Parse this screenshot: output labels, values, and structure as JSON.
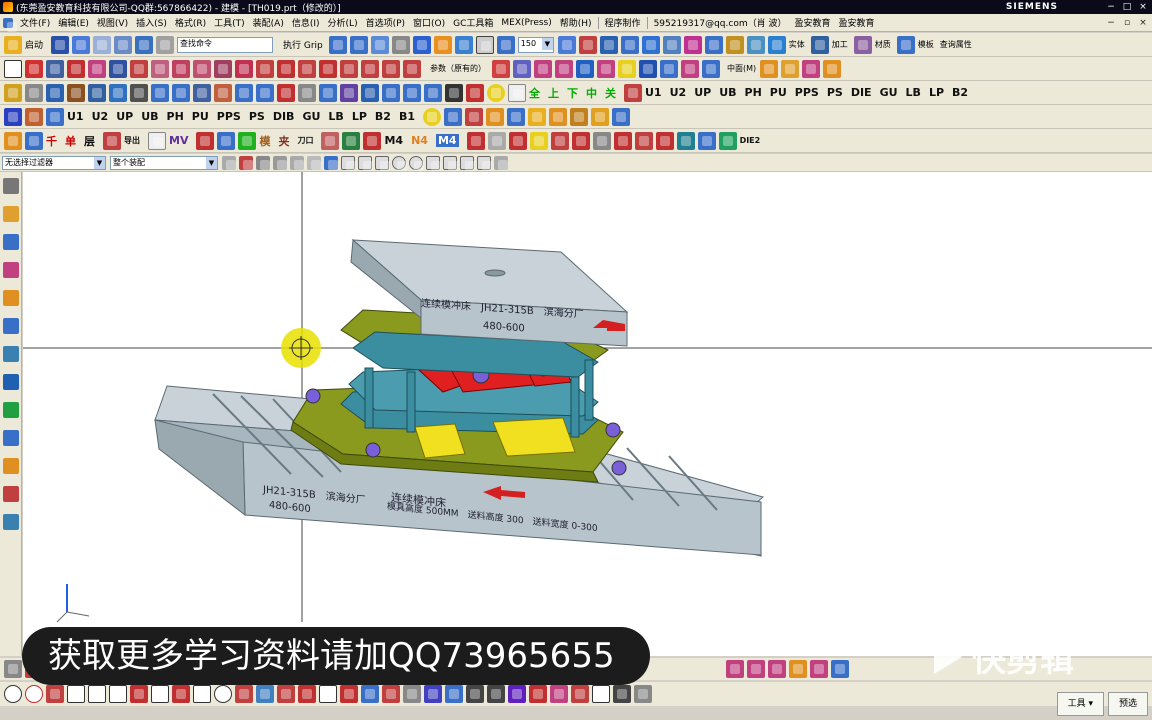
{
  "window": {
    "title": "(东莞盈安教育科技有限公司-QQ群:567866422) - 建模 - [TH019.prt（修改的）]",
    "brand": "SIEMENS",
    "controls": [
      "−",
      "□",
      "×"
    ]
  },
  "menu": [
    "文件(F)",
    "编辑(E)",
    "视图(V)",
    "插入(S)",
    "格式(R)",
    "工具(T)",
    "装配(A)",
    "信息(I)",
    "分析(L)",
    "首选项(P)",
    "窗口(O)",
    "GC工具箱",
    "MEX(Press)",
    "帮助(H)",
    "程序制作",
    "595219317@qq.com（肖 波）",
    "盈安教育",
    "盈安教育"
  ],
  "toolbar1": {
    "start_label": "启动",
    "search_placeholder": "查找命令",
    "grip_label": "执行 Grip",
    "zoom_value": "150",
    "right_labels": [
      "实体",
      "加工",
      "材质",
      "模板",
      "查询属性"
    ]
  },
  "toolbar2": {
    "params_label": "参数（原有的）",
    "midplane_label": "中面(M)"
  },
  "toolbar3": {
    "labels": [
      "U1",
      "U2",
      "UP",
      "UB",
      "PH",
      "PU",
      "PPS",
      "PS",
      "DIB",
      "GU",
      "LB",
      "LP",
      "B2",
      "B1"
    ],
    "green_labels": [
      "全",
      "上",
      "下",
      "中",
      "关"
    ],
    "right_labels": [
      "U1",
      "U2",
      "UP",
      "UB",
      "PH",
      "PU",
      "PPS",
      "PS",
      "DIE",
      "GU",
      "LB",
      "LP",
      "B2"
    ]
  },
  "toolbar4": {
    "labels": [
      "千",
      "单",
      "层",
      "导出",
      "MV",
      "模",
      "夹",
      "刀口",
      "M4",
      "N4",
      "M4",
      "DIE2"
    ]
  },
  "filter": {
    "selection_filter": "无选择过滤器",
    "scope": "整个装配"
  },
  "model": {
    "top_plate_text": "连续模冲床　JH21-315B　滨海分厂",
    "top_plate_range": "480-600",
    "base_text_left": "JH21-315B　滨海分厂",
    "base_range": "480-600",
    "base_title": "连续模冲床",
    "base_specs": "模具高度 500MM　送料高度 300　送料宽度 0-300"
  },
  "banner": {
    "text": "获取更多学习资料请加QQ73965655",
    "watermark": "快剪辑"
  },
  "bottom_buttons": [
    "工具 ▾",
    "预选"
  ],
  "colors": {
    "plate": "#b8c4cc",
    "die_green": "#8a9a1e",
    "die_red": "#e02020",
    "die_yellow": "#f0e020",
    "die_teal": "#3a8ea0",
    "arrow_red": "#d42020",
    "crosshair_yellow": "#e8e000"
  }
}
